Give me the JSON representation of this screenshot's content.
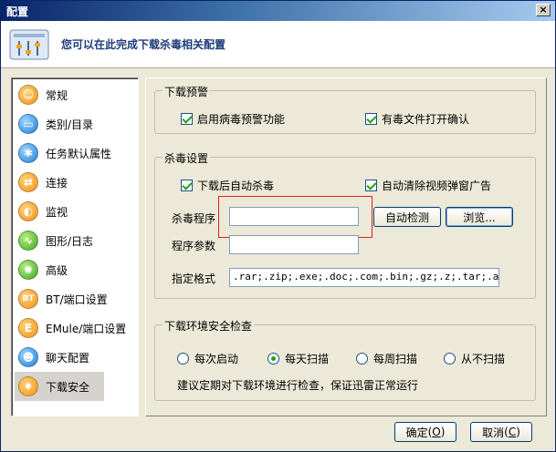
{
  "window": {
    "title": "配置",
    "close_glyph": "×"
  },
  "header": {
    "title": "您可以在此完成下载杀毒相关配置",
    "icon": "settings-panel-icon"
  },
  "sidebar": {
    "items": [
      {
        "label": "常规",
        "icon": "user-icon",
        "glyph": "☺"
      },
      {
        "label": "类别/目录",
        "icon": "folder-icon",
        "glyph": "▭"
      },
      {
        "label": "任务默认属性",
        "icon": "gear-icon",
        "glyph": "✱"
      },
      {
        "label": "连接",
        "icon": "connection-icon",
        "glyph": "⇄"
      },
      {
        "label": "监视",
        "icon": "monitor-icon",
        "glyph": "◐"
      },
      {
        "label": "图形/日志",
        "icon": "chart-icon",
        "glyph": "∿"
      },
      {
        "label": "高级",
        "icon": "advanced-icon",
        "glyph": "✺"
      },
      {
        "label": "BT/端口设置",
        "icon": "bt-icon",
        "glyph": "BT"
      },
      {
        "label": "EMule/端口设置",
        "icon": "emule-icon",
        "glyph": "E"
      },
      {
        "label": "聊天配置",
        "icon": "chat-icon",
        "glyph": "☻"
      },
      {
        "label": "下载安全",
        "icon": "shield-icon",
        "glyph": "♦",
        "active": true
      }
    ]
  },
  "download_warning": {
    "legend": "下载预警",
    "enable_virus_warning": {
      "label": "启用病毒预警功能",
      "checked": true
    },
    "confirm_open_infected": {
      "label": "有毒文件打开确认",
      "checked": true
    }
  },
  "antivirus": {
    "legend": "杀毒设置",
    "auto_scan_after_download": {
      "label": "下载后自动杀毒",
      "checked": true
    },
    "auto_remove_video_popups": {
      "label": "自动清除视频弹窗广告",
      "checked": true
    },
    "program_label": "杀毒程序",
    "program_value": "",
    "auto_detect_button": "自动检测",
    "browse_button": "浏览...",
    "params_label": "程序参数",
    "params_value": "",
    "formats_label": "指定格式",
    "formats_value": ".rar;.zip;.exe;.doc;.com;.bin;.gz;.z;.tar;.arj;.l"
  },
  "env_check": {
    "legend": "下载环境安全检查",
    "options": [
      {
        "label": "每次启动",
        "selected": false
      },
      {
        "label": "每天扫描",
        "selected": true
      },
      {
        "label": "每周扫描",
        "selected": false
      },
      {
        "label": "从不扫描",
        "selected": false
      }
    ],
    "hint": "建议定期对下载环境进行检查，保证迅雷正常运行"
  },
  "footer": {
    "ok_label": "确定",
    "ok_key": "O",
    "cancel_label": "取消",
    "cancel_key": "C"
  },
  "colors": {
    "accent": "#0a246a",
    "check": "#21a121",
    "highlight": "#e02020"
  }
}
